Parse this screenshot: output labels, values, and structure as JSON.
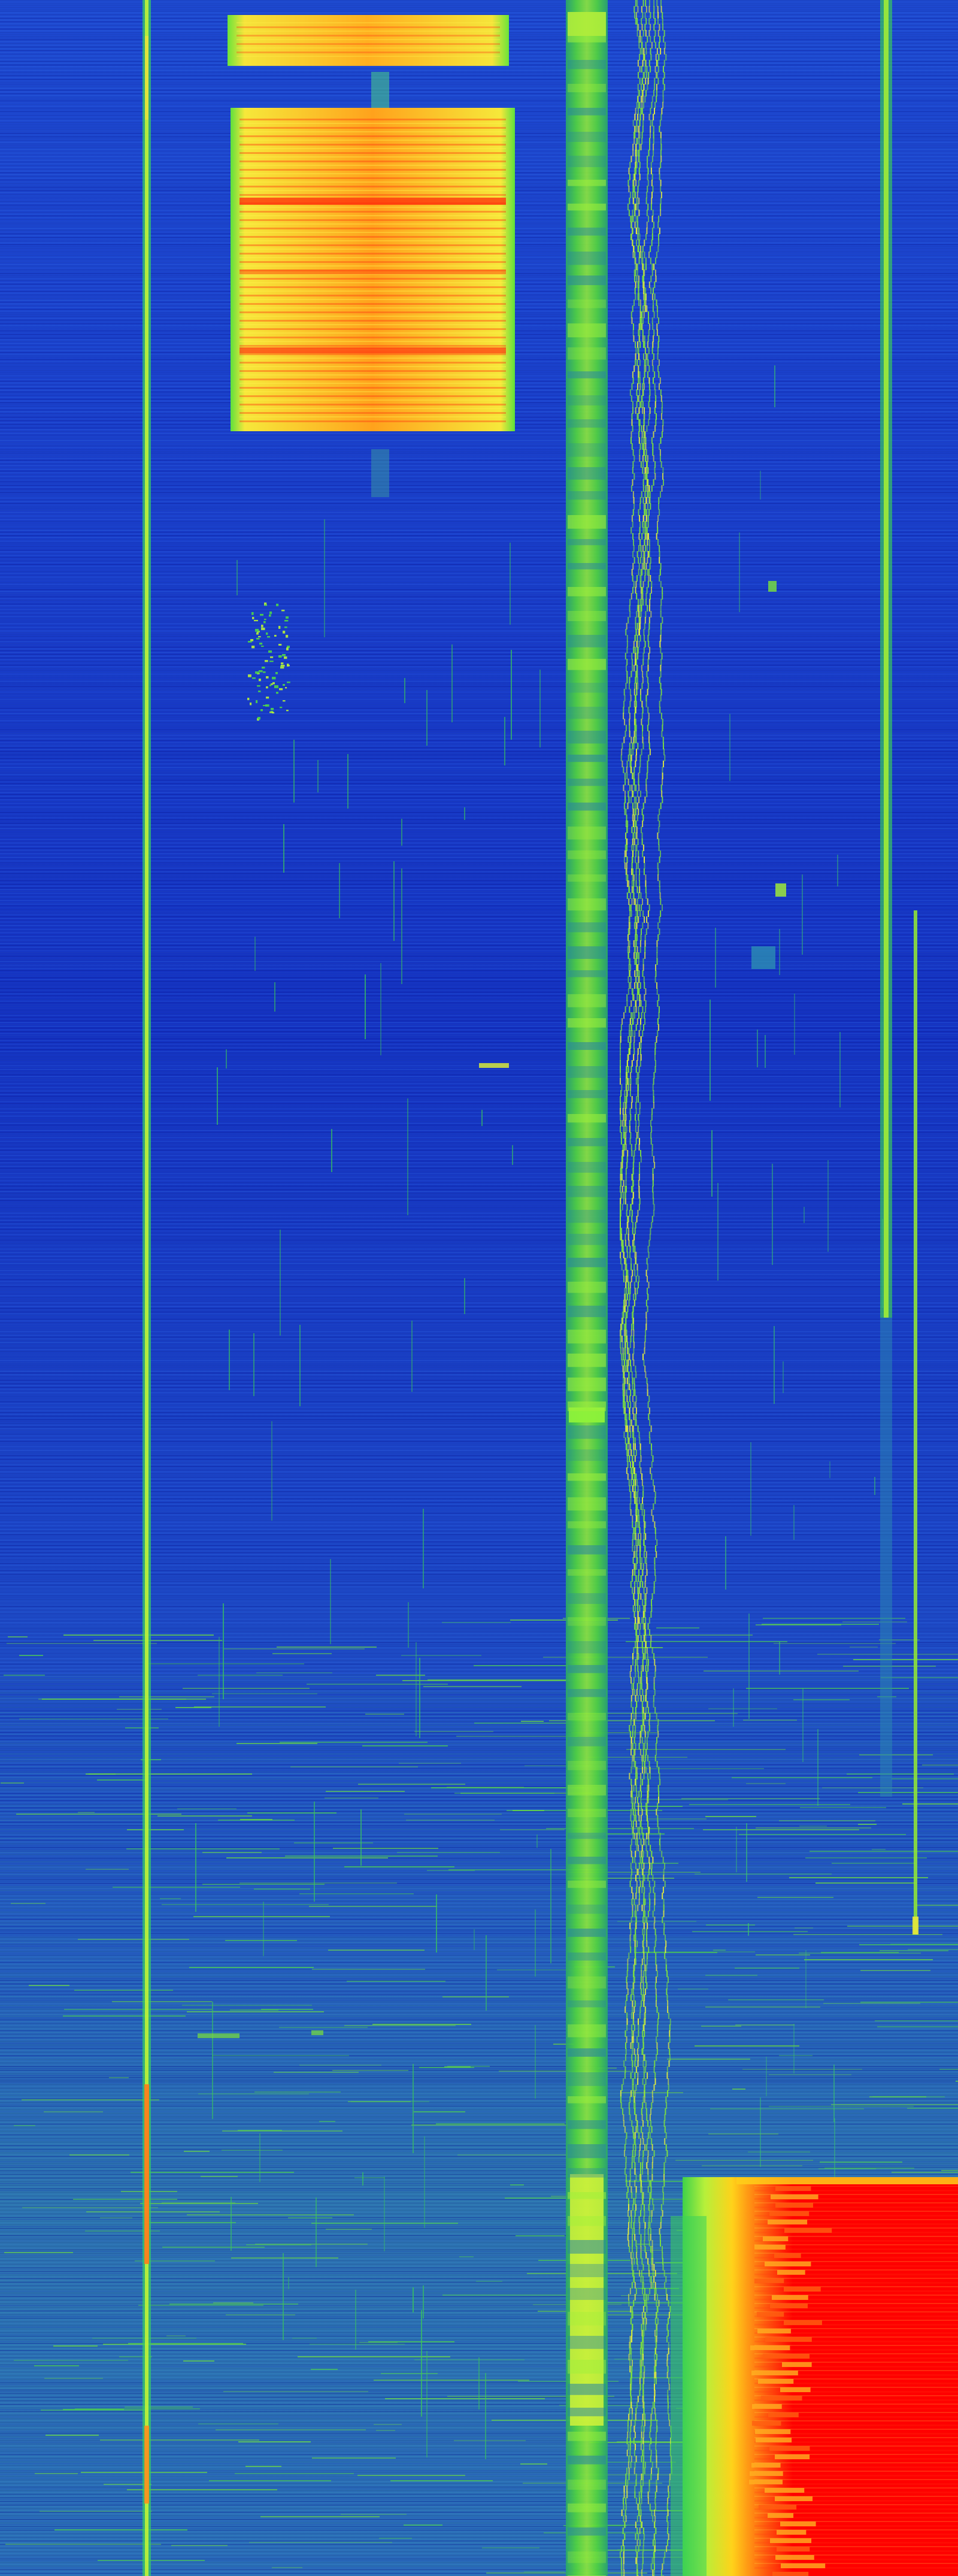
{
  "image": {
    "kind": "spectrogram-waterfall",
    "colormap": [
      "#0a1fb0",
      "#1744e0",
      "#2f6fd8",
      "#3fa2b8",
      "#39d25a",
      "#b9f23b",
      "#f3e13a",
      "#ff7f1a",
      "#ff0000"
    ],
    "background_gradient": {
      "top_color": "#1d49d0",
      "upper_middle_color": "#1634c6",
      "lower_middle_color": "#1d4cc8",
      "bottom_color": "#2a6fb4"
    }
  }
}
